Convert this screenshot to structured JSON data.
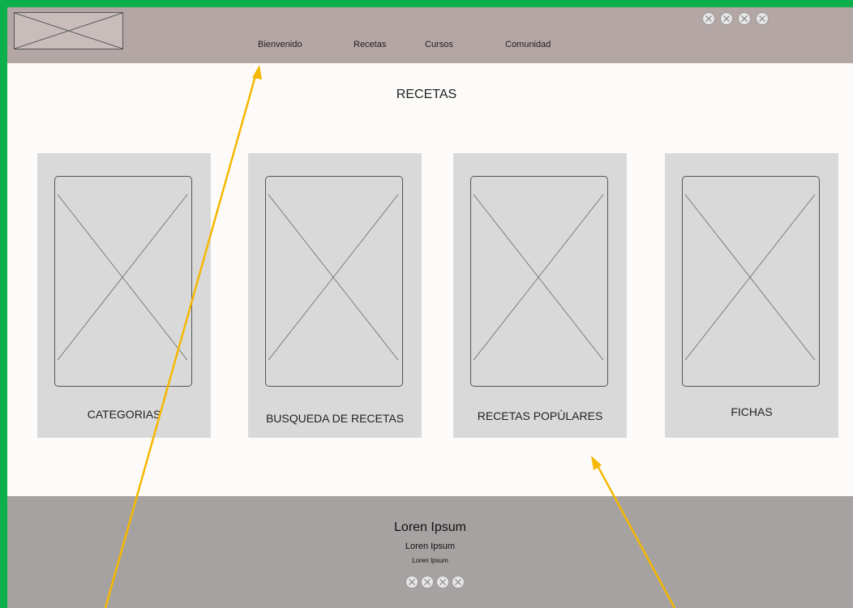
{
  "header": {
    "logo_icon": "image-placeholder-icon",
    "nav": [
      {
        "label": "Bienvenido"
      },
      {
        "label": "Recetas"
      },
      {
        "label": "Cursos"
      },
      {
        "label": "Comunidad"
      }
    ],
    "social_icons": [
      "circle-x-icon",
      "circle-x-icon",
      "circle-x-icon",
      "circle-x-icon"
    ]
  },
  "main": {
    "title": "RECETAS",
    "cards": [
      {
        "label": "CATEGORIAS",
        "icon": "image-placeholder-icon"
      },
      {
        "label": "BUSQUEDA DE RECETAS",
        "icon": "image-placeholder-icon"
      },
      {
        "label": "RECETAS POPÙLARES",
        "icon": "image-placeholder-icon"
      },
      {
        "label": "FICHAS",
        "icon": "image-placeholder-icon"
      }
    ]
  },
  "footer": {
    "title": "Loren Ipsum",
    "subtitle": "Loren Ipsum",
    "small": "Loren Ipsum",
    "social_icons": [
      "circle-x-icon",
      "circle-x-icon",
      "circle-x-icon",
      "circle-x-icon"
    ]
  },
  "colors": {
    "outer_frame": "#0bb04a",
    "header_bg": "#b4a6a4",
    "page_bg": "#fcfbf9",
    "card_bg": "#d9d9d9",
    "footer_bg": "#a6a2a1",
    "annotation_arrow": "#f5b700"
  }
}
